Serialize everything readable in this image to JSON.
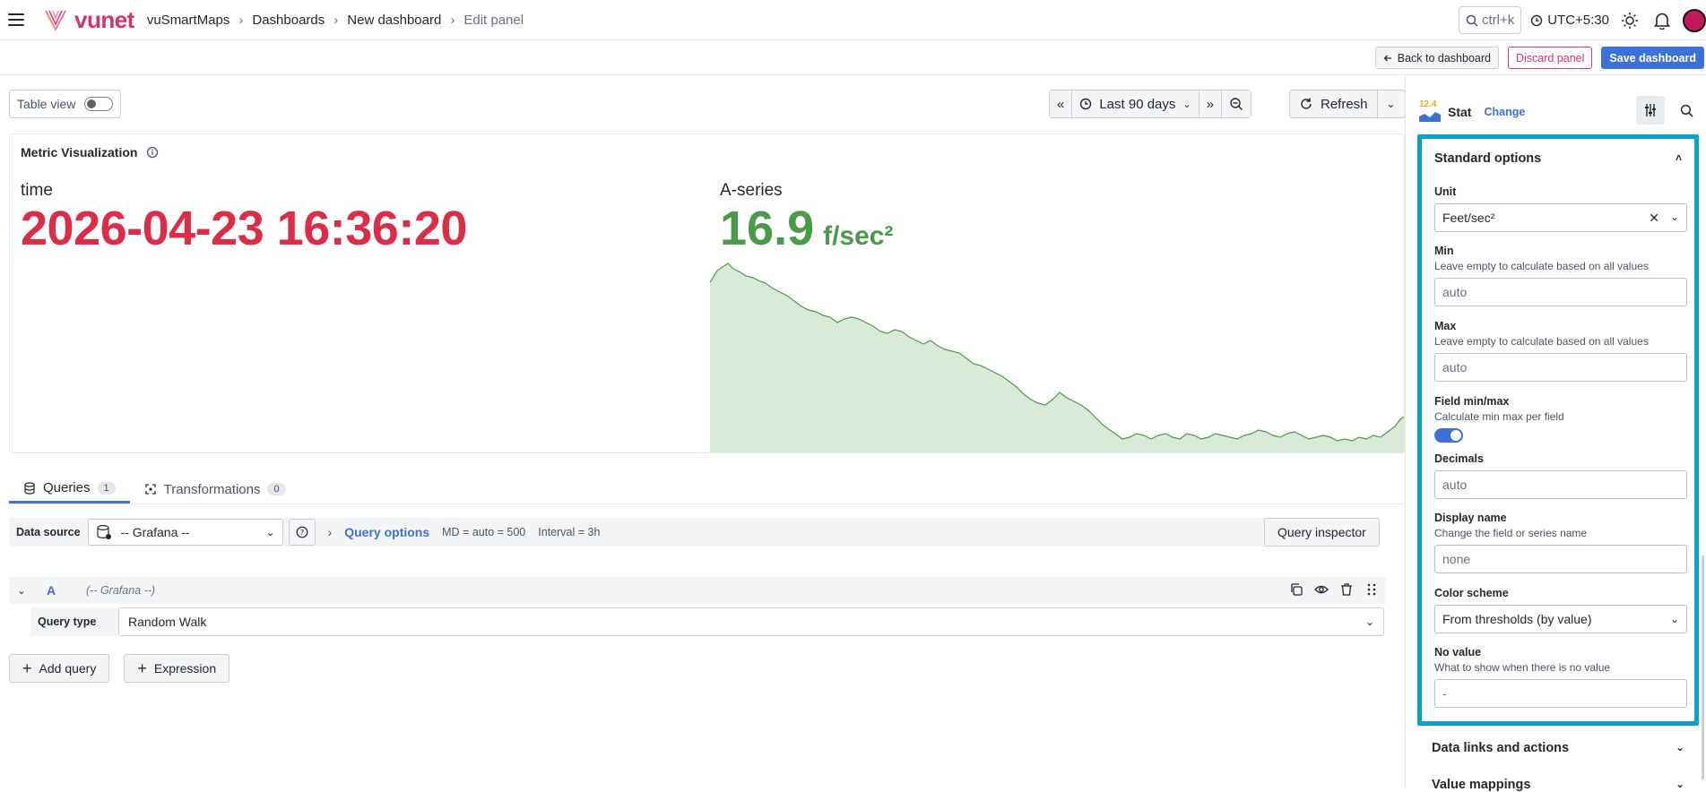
{
  "topbar": {
    "logo_text": "vunet",
    "breadcrumbs": [
      "vuSmartMaps",
      "Dashboards",
      "New dashboard",
      "Edit panel"
    ],
    "search_placeholder": "ctrl+k",
    "timezone": "UTC+5:30"
  },
  "actions": {
    "back": "Back to dashboard",
    "discard": "Discard panel",
    "save": "Save dashboard"
  },
  "toolbar": {
    "table_view": "Table view",
    "time_range": "Last 90 days",
    "refresh": "Refresh"
  },
  "panel": {
    "title": "Metric Visualization",
    "time_label": "time",
    "time_value": "2026-04-23 16:36:20",
    "series_label": "A-series",
    "series_value": "16.9",
    "series_unit": "f/sec²"
  },
  "tabs": [
    {
      "label": "Queries",
      "count": "1"
    },
    {
      "label": "Transformations",
      "count": "0"
    }
  ],
  "query_bar": {
    "ds_label": "Data source",
    "ds_value": "-- Grafana --",
    "options_title": "Query options",
    "md": "MD = auto = 500",
    "interval": "Interval = 3h",
    "inspector": "Query inspector"
  },
  "query": {
    "ref": "A",
    "ds": "(-- Grafana --)",
    "type_label": "Query type",
    "type_value": "Random Walk",
    "add_query": "Add query",
    "expression": "Expression"
  },
  "viz": {
    "badge": "12.4",
    "name": "Stat",
    "change": "Change"
  },
  "standard_options": {
    "title": "Standard options",
    "unit_label": "Unit",
    "unit_value": "Feet/sec²",
    "min_label": "Min",
    "min_desc": "Leave empty to calculate based on all values",
    "min_placeholder": "auto",
    "max_label": "Max",
    "max_desc": "Leave empty to calculate based on all values",
    "max_placeholder": "auto",
    "fmm_label": "Field min/max",
    "fmm_desc": "Calculate min max per field",
    "decimals_label": "Decimals",
    "decimals_placeholder": "auto",
    "display_label": "Display name",
    "display_desc": "Change the field or series name",
    "display_placeholder": "none",
    "color_label": "Color scheme",
    "color_value": "From thresholds (by value)",
    "novalue_label": "No value",
    "novalue_desc": "What to show when there is no value",
    "novalue_placeholder": "-"
  },
  "collapsed_sections": [
    "Data links and actions",
    "Value mappings"
  ],
  "colors": {
    "accent": "#3d71d9",
    "brand": "#d6336c",
    "time_red": "#dc2d47",
    "value_green": "#4a9b48",
    "highlight": "#0aa3c4"
  }
}
